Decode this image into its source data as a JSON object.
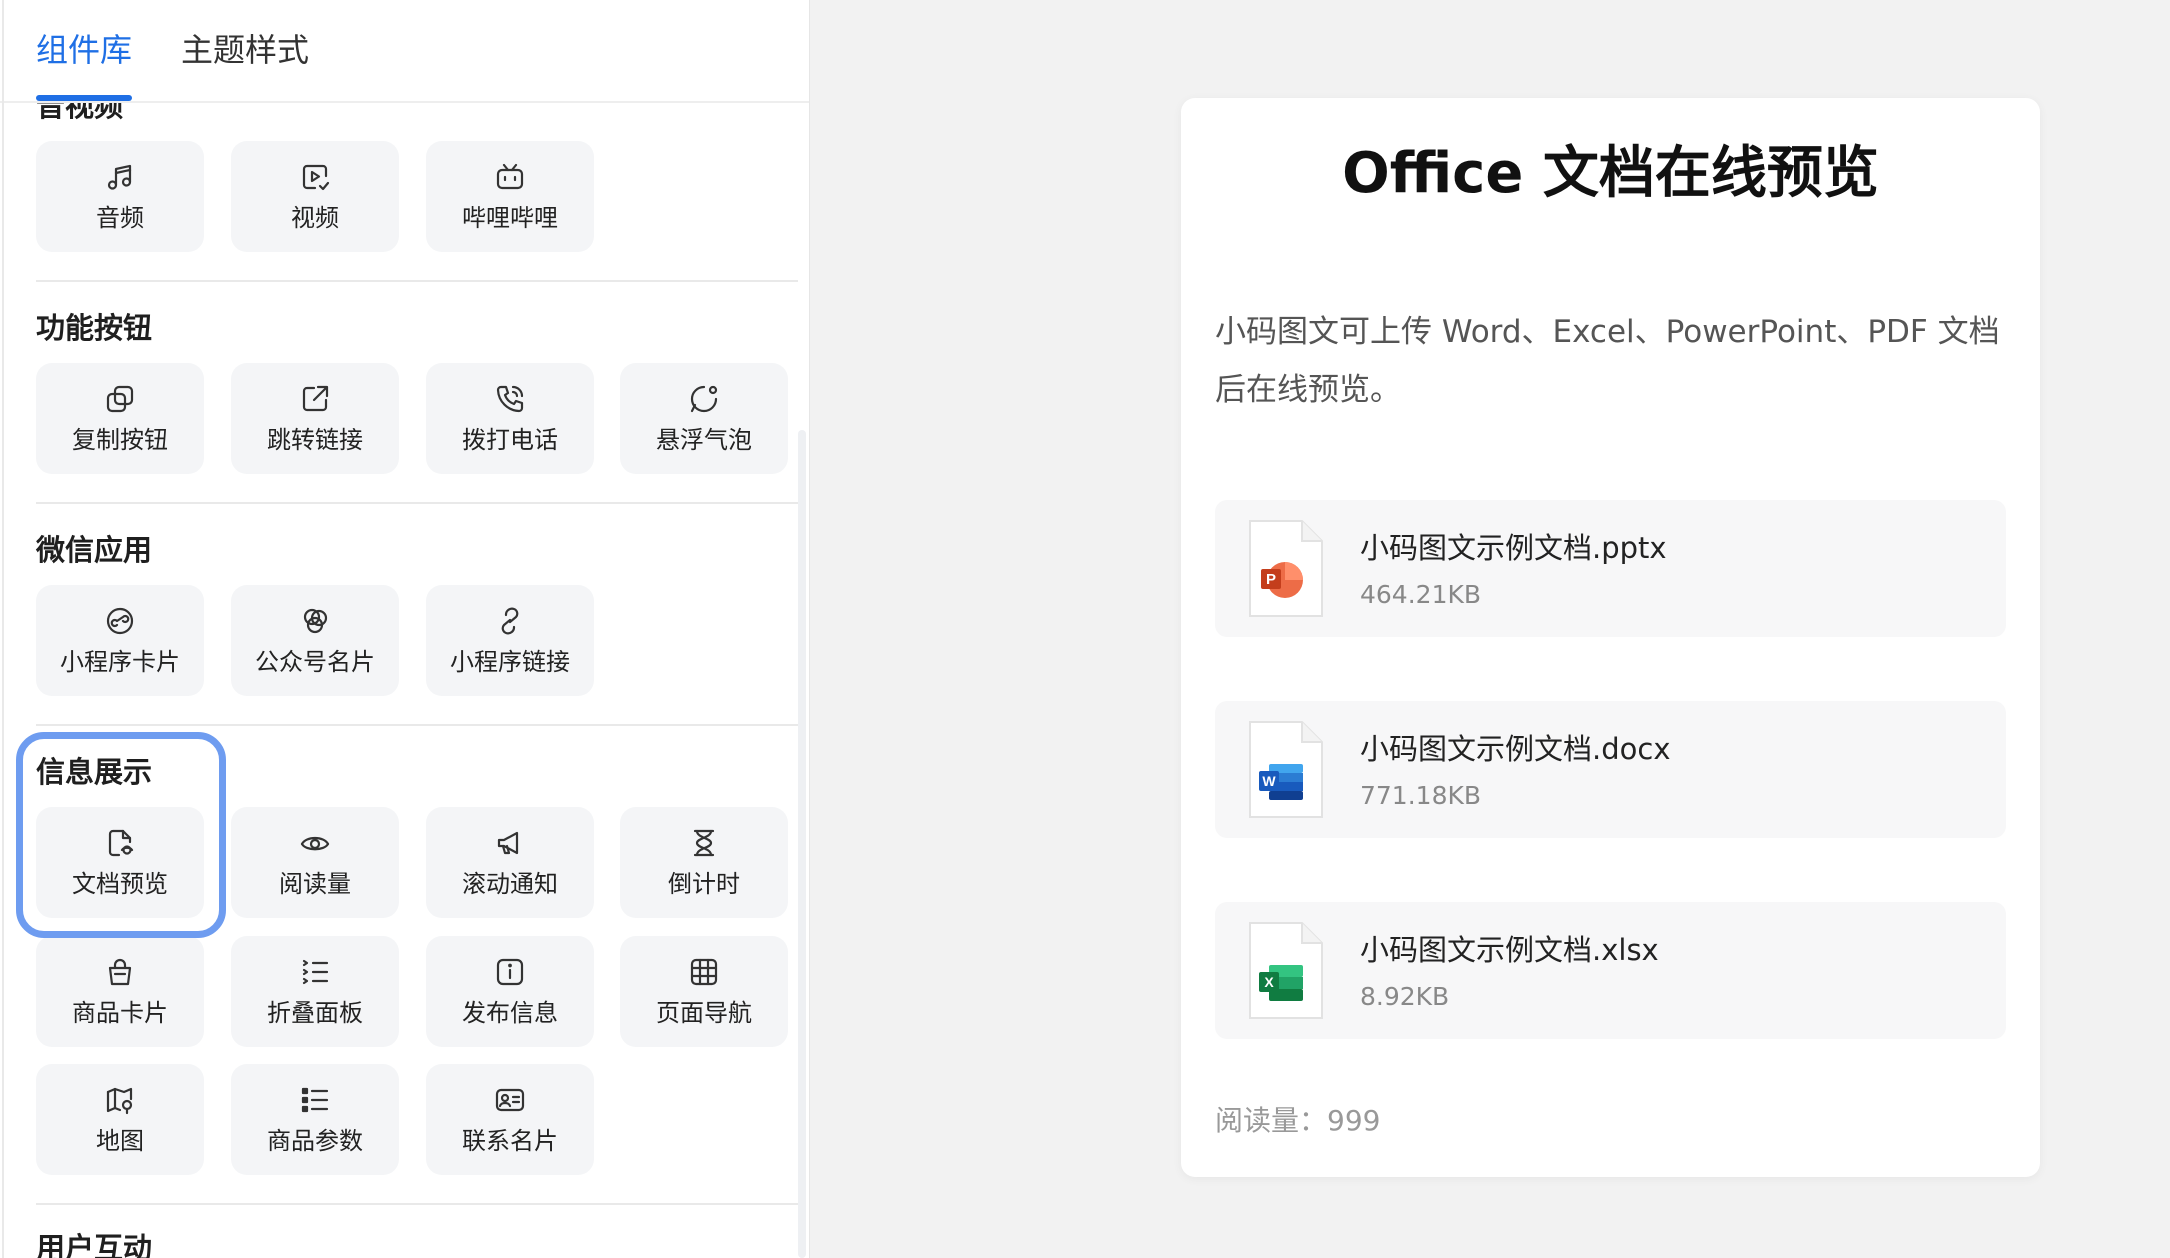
{
  "tabs": [
    {
      "label": "组件库",
      "active": true
    },
    {
      "label": "主题样式",
      "active": false
    }
  ],
  "sections": [
    {
      "title": "音视频",
      "items": [
        {
          "label": "音频",
          "icon": "music-note-icon"
        },
        {
          "label": "视频",
          "icon": "video-icon"
        },
        {
          "label": "哔哩哔哩",
          "icon": "bilibili-icon"
        }
      ]
    },
    {
      "title": "功能按钮",
      "items": [
        {
          "label": "复制按钮",
          "icon": "copy-icon"
        },
        {
          "label": "跳转链接",
          "icon": "external-link-icon"
        },
        {
          "label": "拨打电话",
          "icon": "phone-icon"
        },
        {
          "label": "悬浮气泡",
          "icon": "chat-bubble-icon"
        }
      ]
    },
    {
      "title": "微信应用",
      "items": [
        {
          "label": "小程序卡片",
          "icon": "mini-program-icon"
        },
        {
          "label": "公众号名片",
          "icon": "official-account-icon"
        },
        {
          "label": "小程序链接",
          "icon": "link-icon"
        }
      ]
    },
    {
      "title": "信息展示",
      "items": [
        {
          "label": "文档预览",
          "icon": "document-preview-icon",
          "selected": true
        },
        {
          "label": "阅读量",
          "icon": "eye-icon"
        },
        {
          "label": "滚动通知",
          "icon": "megaphone-icon"
        },
        {
          "label": "倒计时",
          "icon": "hourglass-icon"
        },
        {
          "label": "商品卡片",
          "icon": "shopping-bag-icon"
        },
        {
          "label": "折叠面板",
          "icon": "list-icon"
        },
        {
          "label": "发布信息",
          "icon": "info-icon"
        },
        {
          "label": "页面导航",
          "icon": "grid-icon"
        },
        {
          "label": "地图",
          "icon": "map-icon"
        },
        {
          "label": "商品参数",
          "icon": "bullet-list-icon"
        },
        {
          "label": "联系名片",
          "icon": "contact-card-icon"
        }
      ]
    },
    {
      "title": "用户互动",
      "items": []
    }
  ],
  "preview": {
    "title": "Office 文档在线预览",
    "description": "小码图文可上传 Word、Excel、PowerPoint、PDF 文档后在线预览。",
    "files": [
      {
        "name": "小码图文示例文档.pptx",
        "size": "464.21KB",
        "type": "pptx",
        "badge": "P",
        "color": "#d24726"
      },
      {
        "name": "小码图文示例文档.docx",
        "size": "771.18KB",
        "type": "docx",
        "badge": "W",
        "color": "#185abd"
      },
      {
        "name": "小码图文示例文档.xlsx",
        "size": "8.92KB",
        "type": "xlsx",
        "badge": "X",
        "color": "#107c41"
      }
    ],
    "read_count_label": "阅读量：",
    "read_count": "999"
  },
  "colors": {
    "accent": "#1f6fe5",
    "highlight": "#6e9cf0"
  }
}
